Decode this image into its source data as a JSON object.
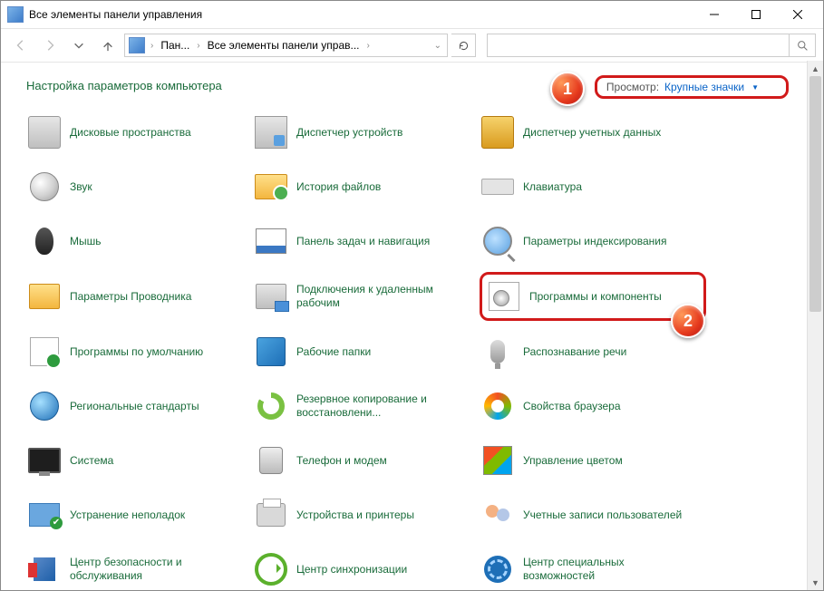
{
  "window": {
    "title": "Все элементы панели управления"
  },
  "nav": {
    "breadcrumb": [
      "Пан...",
      "Все элементы панели управ..."
    ],
    "search_placeholder": ""
  },
  "header": {
    "heading": "Настройка параметров компьютера",
    "view_label": "Просмотр:",
    "view_value": "Крупные значки"
  },
  "callouts": {
    "one": "1",
    "two": "2"
  },
  "items": [
    {
      "label": "Дисковые пространства",
      "icon": "ico-disk"
    },
    {
      "label": "Диспетчер устройств",
      "icon": "ico-device"
    },
    {
      "label": "Диспетчер учетных данных",
      "icon": "ico-creds"
    },
    {
      "label": "Звук",
      "icon": "ico-sound"
    },
    {
      "label": "История файлов",
      "icon": "ico-folder"
    },
    {
      "label": "Клавиатура",
      "icon": "ico-keyboard"
    },
    {
      "label": "Мышь",
      "icon": "ico-mouse"
    },
    {
      "label": "Панель задач и навигация",
      "icon": "ico-taskbar"
    },
    {
      "label": "Параметры индексирования",
      "icon": "ico-index"
    },
    {
      "label": "Параметры Проводника",
      "icon": "ico-explorer"
    },
    {
      "label": "Подключения к удаленным рабочим",
      "icon": "ico-remote"
    },
    {
      "label": "Программы и компоненты",
      "icon": "ico-progs",
      "highlight": true
    },
    {
      "label": "Программы по умолчанию",
      "icon": "ico-default"
    },
    {
      "label": "Рабочие папки",
      "icon": "ico-workfolders"
    },
    {
      "label": "Распознавание речи",
      "icon": "ico-speech"
    },
    {
      "label": "Региональные стандарты",
      "icon": "ico-region"
    },
    {
      "label": "Резервное копирование и восстановлени...",
      "icon": "ico-backup"
    },
    {
      "label": "Свойства браузера",
      "icon": "ico-browser"
    },
    {
      "label": "Система",
      "icon": "ico-system"
    },
    {
      "label": "Телефон и модем",
      "icon": "ico-phone"
    },
    {
      "label": "Управление цветом",
      "icon": "ico-color"
    },
    {
      "label": "Устранение неполадок",
      "icon": "ico-troubleshoot"
    },
    {
      "label": "Устройства и принтеры",
      "icon": "ico-printers"
    },
    {
      "label": "Учетные записи пользователей",
      "icon": "ico-users"
    },
    {
      "label": "Центр безопасности и обслуживания",
      "icon": "ico-security"
    },
    {
      "label": "Центр синхронизации",
      "icon": "ico-sync"
    },
    {
      "label": "Центр специальных возможностей",
      "icon": "ico-access"
    }
  ]
}
